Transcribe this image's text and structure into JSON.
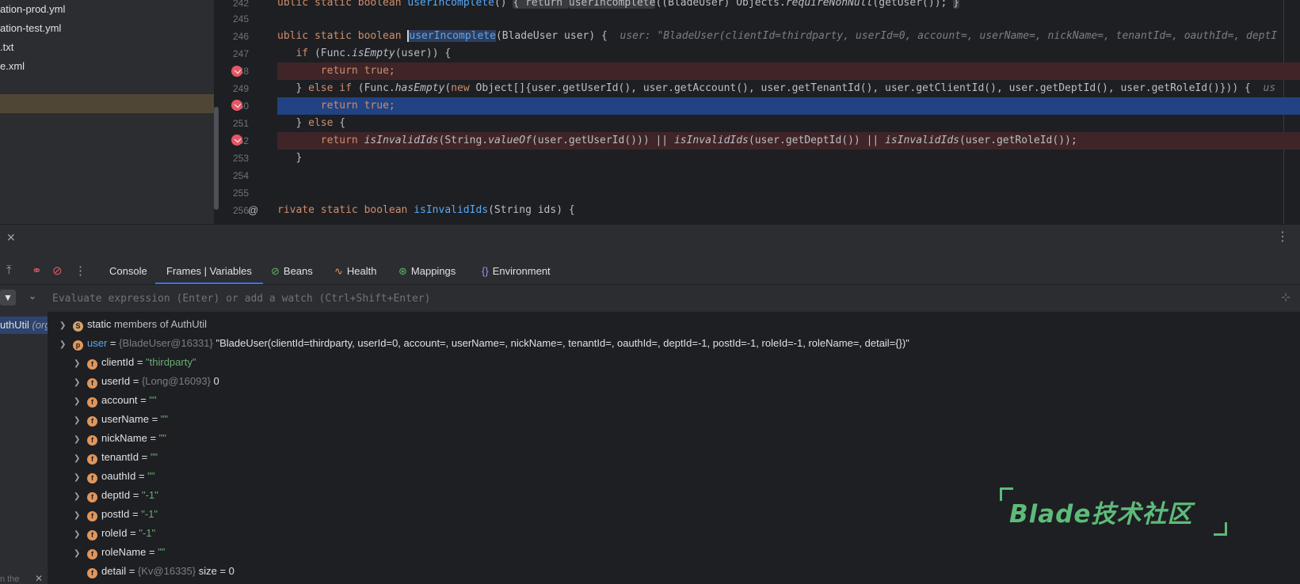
{
  "project_tree": {
    "files": [
      "ation-prod.yml",
      "ation-test.yml",
      ".txt",
      "e.xml"
    ]
  },
  "editor": {
    "line_numbers": [
      "242",
      "245",
      "246",
      "247",
      "248",
      "249",
      "250",
      "251",
      "252",
      "253",
      "254",
      "255",
      "256"
    ],
    "lines": {
      "l242": {
        "pre": "ublic static boolean ",
        "fn": "userIncomplete",
        "mid": "()",
        "box1": "{ return ",
        "call": "userIncomplete",
        "rest": "((BladeUser) Objects.",
        "req": "requireNonNull",
        "tail": "(getUser());",
        "box2": "}"
      },
      "l246": {
        "pre": "ublic static boolean ",
        "fn": "userIncomplete",
        "rest": "(BladeUser user) {",
        "inlay": "user: \"BladeUser(clientId=thirdparty, userId=0, account=, userName=, nickName=, tenantId=, oauthId=, deptI"
      },
      "l247": {
        "kw": "if",
        "a": " (Func.",
        "m": "isEmpty",
        "b": "(user)) {"
      },
      "l248": {
        "kw": "return",
        "b": " true;"
      },
      "l249": {
        "a": "} ",
        "kw1": "else if",
        "b": " (Func.",
        "m": "hasEmpty",
        "c": "(",
        "kw2": "new",
        "d": " Object[]{user.getUserId(), user.getAccount(), user.getTenantId(), user.getClientId(), user.getDeptId(), user.getRoleId()})) {",
        "inlay": "us"
      },
      "l250": {
        "kw": "return",
        "b": " true;"
      },
      "l251": {
        "a": "} ",
        "kw": "else",
        "b": " {"
      },
      "l252": {
        "kw": "return",
        "m1": "isInvalidIds",
        "a": "(String.",
        "m2": "valueOf",
        "b": "(user.getUserId())) || ",
        "m3": "isInvalidIds",
        "c": "(user.getDeptId()) || ",
        "m4": "isInvalidIds",
        "d": "(user.getRoleId());"
      },
      "l253": {
        "a": "}"
      },
      "l256": {
        "pre": "rivate static boolean ",
        "fn": "isInvalidIds",
        "rest": "(String ids) {"
      }
    }
  },
  "debug": {
    "tabs": [
      {
        "label": "Console"
      },
      {
        "label": "Frames | Variables"
      },
      {
        "label": "Beans"
      },
      {
        "label": "Health"
      },
      {
        "label": "Mappings"
      },
      {
        "label": "Environment"
      }
    ],
    "eval_placeholder": "Evaluate expression (Enter) or add a watch (Ctrl+Shift+Enter)",
    "frame": {
      "name": "uthUtil",
      "suffix": "(org"
    },
    "frames_hint": "n the"
  },
  "variables": {
    "static_row": {
      "badge": "S",
      "label": "static",
      "rest": " members of AuthUtil"
    },
    "user_row": {
      "badge": "p",
      "name": "user",
      "eq": " = ",
      "ref": "{BladeUser@16331}",
      "value": " \"BladeUser(clientId=thirdparty, userId=0, account=, userName=, nickName=, tenantId=, oauthId=, deptId=-1, postId=-1, roleId=-1, roleName=, detail={})\""
    },
    "fields": [
      {
        "name": "clientId",
        "ref": "",
        "value": "\"thirdparty\"",
        "kind": "str"
      },
      {
        "name": "userId",
        "ref": "{Long@16093}",
        "value": "0",
        "kind": "plain"
      },
      {
        "name": "account",
        "ref": "",
        "value": "\"\"",
        "kind": "str"
      },
      {
        "name": "userName",
        "ref": "",
        "value": "\"\"",
        "kind": "str"
      },
      {
        "name": "nickName",
        "ref": "",
        "value": "\"\"",
        "kind": "str"
      },
      {
        "name": "tenantId",
        "ref": "",
        "value": "\"\"",
        "kind": "str"
      },
      {
        "name": "oauthId",
        "ref": "",
        "value": "\"\"",
        "kind": "str"
      },
      {
        "name": "deptId",
        "ref": "",
        "value": "\"-1\"",
        "kind": "str"
      },
      {
        "name": "postId",
        "ref": "",
        "value": "\"-1\"",
        "kind": "str"
      },
      {
        "name": "roleId",
        "ref": "",
        "value": "\"-1\"",
        "kind": "str"
      },
      {
        "name": "roleName",
        "ref": "",
        "value": "\"\"",
        "kind": "str"
      },
      {
        "name": "detail",
        "ref": "{Kv@16335}",
        "value": " size = 0",
        "kind": "plain"
      }
    ],
    "field_badge": "f",
    "eq": " = "
  },
  "watermark": {
    "text": "Blade技术社区"
  },
  "colors": {
    "accent": "#3574f0",
    "breakpoint": "#e55765",
    "string": "#6aab73",
    "keyword": "#cf8e6d",
    "method": "#56a8f5"
  },
  "icons": [
    "close-icon",
    "more-icon",
    "step-out-icon",
    "mute-breakpoints-icon",
    "view-breakpoints-icon",
    "beans-icon",
    "health-icon",
    "mappings-icon",
    "environment-icon",
    "filter-icon",
    "chevron-down-icon",
    "add-watch-icon",
    "breakpoint-icon",
    "override-icon"
  ]
}
